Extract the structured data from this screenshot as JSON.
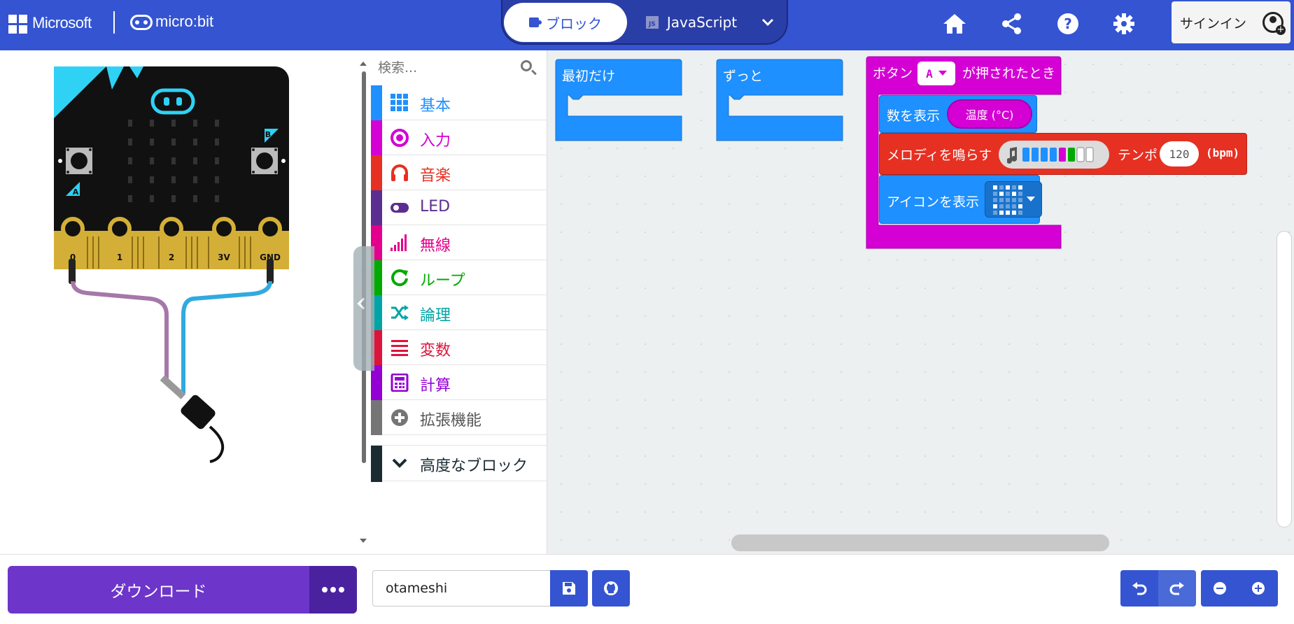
{
  "header": {
    "brand": "Microsoft",
    "product": "micro:bit",
    "tabs": {
      "blocks": "ブロック",
      "javascript": "JavaScript"
    },
    "signin": "サインイン"
  },
  "simulator": {
    "buttons": {
      "a": "A",
      "b": "B"
    },
    "pins": [
      "0",
      "1",
      "2",
      "3V",
      "GND"
    ]
  },
  "toolbox": {
    "search_placeholder": "検索...",
    "categories": [
      {
        "label": "基本",
        "color": "#1e90ff",
        "icon": "grid-icon"
      },
      {
        "label": "入力",
        "color": "#d400d4",
        "icon": "circle-dot-icon"
      },
      {
        "label": "音楽",
        "color": "#e63022",
        "icon": "headphones-icon"
      },
      {
        "label": "LED",
        "color": "#5c2d91",
        "icon": "toggle-icon"
      },
      {
        "label": "無線",
        "color": "#e3008c",
        "icon": "signal-bars-icon"
      },
      {
        "label": "ループ",
        "color": "#00aa00",
        "icon": "loop-icon"
      },
      {
        "label": "論理",
        "color": "#00a4a6",
        "icon": "shuffle-icon"
      },
      {
        "label": "変数",
        "color": "#dc143c",
        "icon": "lines-icon"
      },
      {
        "label": "計算",
        "color": "#9400d3",
        "icon": "calculator-icon"
      },
      {
        "label": "拡張機能",
        "color": "#757575",
        "icon": "plus-circle-icon"
      }
    ],
    "advanced": "高度なブロック"
  },
  "workspace": {
    "on_start": "最初だけ",
    "forever": "ずっと",
    "button_block": {
      "prefix": "ボタン",
      "button": "A",
      "suffix": "が押されたとき"
    },
    "show_number": {
      "label": "数を表示",
      "value": "温度 (°C)"
    },
    "melody": {
      "label": "メロディを鳴らす",
      "tempo_label": "テンポ",
      "tempo": "120",
      "unit": "(bpm)"
    },
    "show_icon": {
      "label": "アイコンを表示"
    }
  },
  "bottom": {
    "download": "ダウンロード",
    "project_name": "otameshi"
  }
}
